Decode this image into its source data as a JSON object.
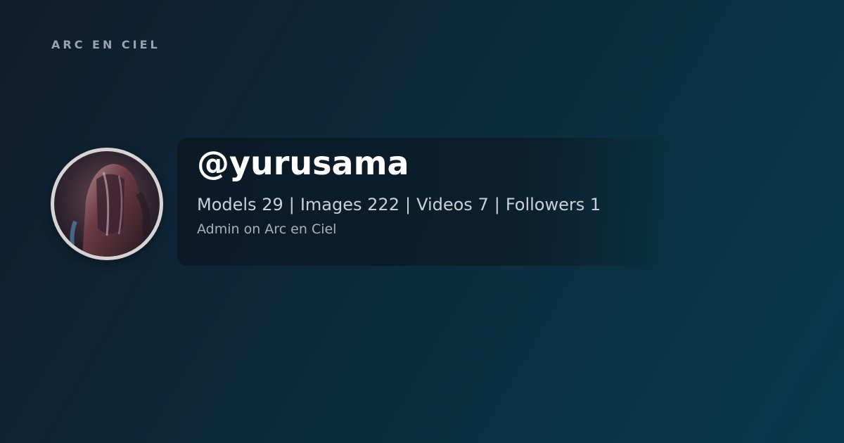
{
  "brand": {
    "name": "ARC EN CIEL"
  },
  "profile": {
    "handle": "@yurusama",
    "avatar_icon": "armored-helmet-avatar",
    "subtitle": "Admin on Arc en Ciel",
    "stats": [
      {
        "label": "Models",
        "value": "29"
      },
      {
        "label": "Images",
        "value": "222"
      },
      {
        "label": "Videos",
        "value": "7"
      },
      {
        "label": "Followers",
        "value": "1"
      }
    ],
    "separator": "|"
  },
  "colors": {
    "background_start": "#111c2b",
    "background_end": "#08384a",
    "text_primary": "#ffffff",
    "text_secondary": "#c9d0d8",
    "brand_text": "#9aa3ae",
    "avatar_ring": "#d7d2d4"
  }
}
